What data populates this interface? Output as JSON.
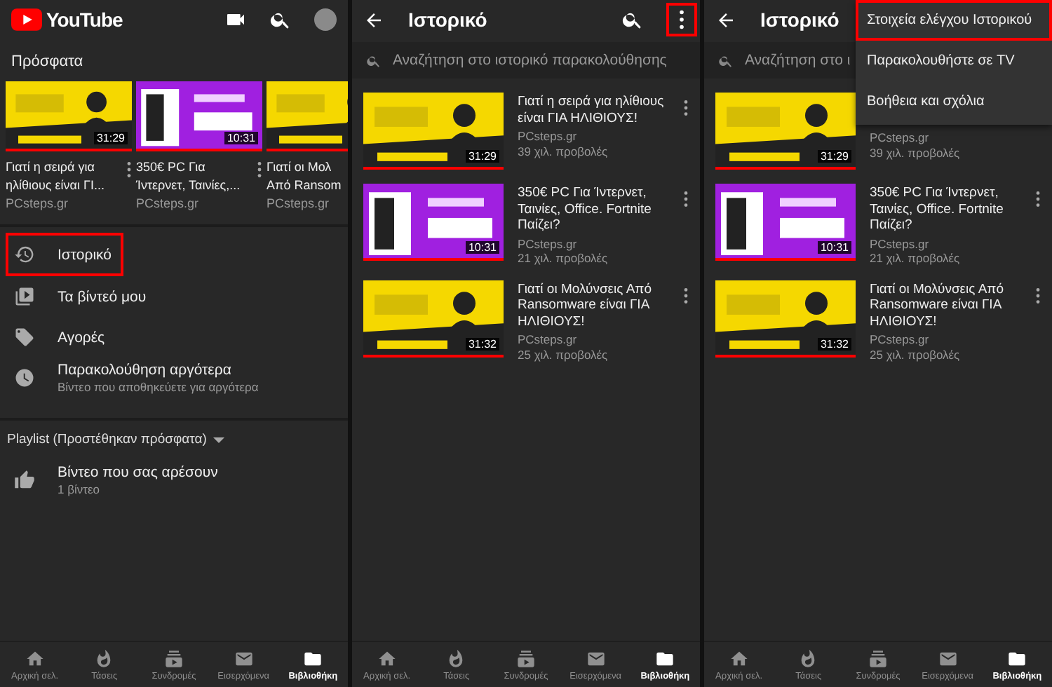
{
  "panels": [
    {
      "kind": "library",
      "logo": "YouTube",
      "header_actions": [
        {
          "kind": "camera"
        },
        {
          "kind": "search"
        },
        {
          "kind": "avatar"
        }
      ],
      "section_title": "Πρόσφατα",
      "recent": [
        {
          "thumb": {
            "kind": "picture",
            "level": 1,
            "duration": "31:29"
          },
          "title_lines": [
            "Γιατί η σειρά για",
            "ηλίθιους είναι ΓΙ..."
          ],
          "channel": "PCsteps.gr",
          "more": true
        },
        {
          "thumb": {
            "kind": "picture",
            "level": 1,
            "duration": "10:31"
          },
          "title_lines": [
            "350€ PC Για",
            "Ίντερνετ, Ταινίες,..."
          ],
          "channel": "PCsteps.gr",
          "more": true
        },
        {
          "thumb": {
            "kind": "picture",
            "level": 1
          },
          "title_lines": [
            "Γιατί οι Μολ",
            "Από Ransom"
          ],
          "channel": "PCsteps.gr",
          "more": false
        }
      ],
      "menu": [
        {
          "label": "Ιστορικό",
          "highlighted": true
        },
        {
          "label": "Τα βίντεό μου",
          "highlighted": false
        },
        {
          "label": "Αγορές",
          "highlighted": false
        },
        {
          "label": "Παρακολούθηση αργότερα",
          "sub": "Βίντεο που αποθηκεύετε για αργότερα",
          "highlighted": false
        }
      ],
      "playlist_header": "Playlist (Προστέθηκαν πρόσφατα)",
      "playlists": [
        {
          "label": "Βίντεο που σας αρέσουν",
          "sub": "1 βίντεο"
        }
      ],
      "nav": [
        {
          "label": "Αρχική σελ.",
          "selected": false
        },
        {
          "label": "Τάσεις",
          "selected": false
        },
        {
          "label": "Συνδρομές",
          "selected": false
        },
        {
          "label": "Εισερχόμενα",
          "selected": false
        },
        {
          "label": "Βιβλιοθήκη",
          "selected": true
        }
      ]
    },
    {
      "kind": "history",
      "title": "Ιστορικό",
      "header_actions": [
        {
          "kind": "search"
        },
        {
          "kind": "more",
          "highlighted": true
        }
      ],
      "search_placeholder": "Αναζήτηση στο ιστορικό παρακολούθησης",
      "videos": [
        {
          "thumb": {
            "kind": "picture",
            "level": 1,
            "duration": "31:29"
          },
          "title": "Γιατί η σειρά για ηλίθιους είναι ΓΙΑ ΗΛΙΘΙΟΥΣ!",
          "channel": "PCsteps.gr",
          "views": "39 χιλ. προβολές",
          "more": true
        },
        {
          "thumb": {
            "kind": "picture",
            "level": 1,
            "duration": "10:31"
          },
          "title": "350€ PC Για Ίντερνετ, Ταινίες, Office. Fortnite Παίζει?",
          "channel": "PCsteps.gr",
          "views": "21 χιλ. προβολές",
          "more": true
        },
        {
          "thumb": {
            "kind": "picture",
            "level": 1,
            "duration": "31:32"
          },
          "title": "Γιατί οι Μολύνσεις Από Ransomware είναι ΓΙΑ ΗΛΙΘΙΟΥΣ!",
          "channel": "PCsteps.gr",
          "views": "25 χιλ. προβολές",
          "more": true
        }
      ],
      "nav": [
        {
          "label": "Αρχική σελ.",
          "selected": false
        },
        {
          "label": "Τάσεις",
          "selected": false
        },
        {
          "label": "Συνδρομές",
          "selected": false
        },
        {
          "label": "Εισερχόμενα",
          "selected": false
        },
        {
          "label": "Βιβλιοθήκη",
          "selected": true
        }
      ]
    },
    {
      "kind": "history",
      "title": "Ιστορικό",
      "search_placeholder": "Αναζήτηση στο ι",
      "videos": [
        {
          "thumb": {
            "kind": "picture",
            "level": 1,
            "duration": "31:29"
          },
          "channel": "PCsteps.gr",
          "views": "39 χιλ. προβολές",
          "more": false
        },
        {
          "thumb": {
            "kind": "picture",
            "level": 1,
            "duration": "10:31"
          },
          "title": "350€ PC Για Ίντερνετ, Ταινίες, Office. Fortnite Παίζει?",
          "channel": "PCsteps.gr",
          "views": "21 χιλ. προβολές",
          "more": true
        },
        {
          "thumb": {
            "kind": "picture",
            "level": 1,
            "duration": "31:32"
          },
          "title": "Γιατί οι Μολύνσεις Από Ransomware είναι ΓΙΑ ΗΛΙΘΙΟΥΣ!",
          "channel": "PCsteps.gr",
          "views": "25 χιλ. προβολές",
          "more": true
        }
      ],
      "dropdown": [
        {
          "label": "Στοιχεία ελέγχου Ιστορικού",
          "highlighted": true
        },
        {
          "label": "Παρακολουθήστε σε TV",
          "highlighted": false
        },
        {
          "label": "Βοήθεια και σχόλια",
          "highlighted": false
        }
      ],
      "nav": [
        {
          "label": "Αρχική σελ.",
          "selected": false
        },
        {
          "label": "Τάσεις",
          "selected": false
        },
        {
          "label": "Συνδρομές",
          "selected": false
        },
        {
          "label": "Εισερχόμενα",
          "selected": false
        },
        {
          "label": "Βιβλιοθήκη",
          "selected": true
        }
      ]
    }
  ]
}
